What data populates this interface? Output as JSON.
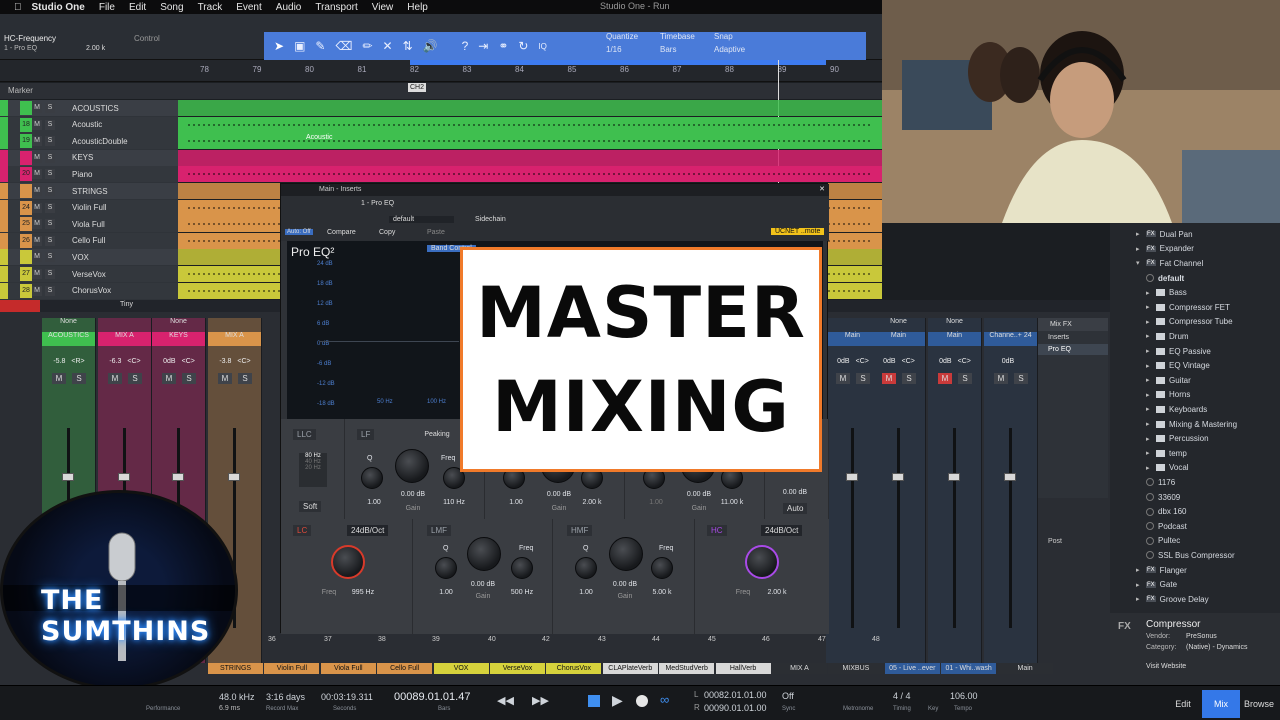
{
  "menubar": {
    "app": "Studio One",
    "items": [
      "File",
      "Edit",
      "Song",
      "Track",
      "Event",
      "Audio",
      "Transport",
      "View",
      "Help"
    ],
    "window_title": "Studio One - Run"
  },
  "toolbar": {
    "param_name": "HC-Frequency",
    "insert_name": "1 - Pro EQ",
    "param_value": "2.00 k",
    "control_label": "Control",
    "quantize_label": "Quantize",
    "quantize_value": "1/16",
    "timebase_label": "Timebase",
    "timebase_value": "Bars",
    "snap_label": "Snap",
    "snap_value": "Adaptive",
    "iq_label": "IQ"
  },
  "ruler": {
    "bars": [
      "78",
      "79",
      "80",
      "81",
      "82",
      "83",
      "84",
      "85",
      "86",
      "87",
      "88",
      "89",
      "90"
    ],
    "marker_label": "Marker",
    "marker_flag": "CH2"
  },
  "tracks": [
    {
      "num": "",
      "name": "ACOUSTICS",
      "color": "#3fbf4f",
      "folder": true
    },
    {
      "num": "18",
      "name": "Acoustic",
      "color": "#3fbf4f",
      "folder": false
    },
    {
      "num": "19",
      "name": "AcousticDouble",
      "color": "#3fbf4f",
      "folder": false
    },
    {
      "num": "",
      "name": "KEYS",
      "color": "#d8226e",
      "folder": true
    },
    {
      "num": "20",
      "name": "Piano",
      "color": "#d8226e",
      "folder": false
    },
    {
      "num": "",
      "name": "STRINGS",
      "color": "#d9944a",
      "folder": true
    },
    {
      "num": "24",
      "name": "Violin Full",
      "color": "#d9944a",
      "folder": false
    },
    {
      "num": "25",
      "name": "Viola Full",
      "color": "#d9944a",
      "folder": false
    },
    {
      "num": "26",
      "name": "Cello Full",
      "color": "#d9944a",
      "folder": false
    },
    {
      "num": "",
      "name": "VOX",
      "color": "#c9c83a",
      "folder": true
    },
    {
      "num": "27",
      "name": "VerseVox",
      "color": "#c9c83a",
      "folder": false
    },
    {
      "num": "28",
      "name": "ChorusVox",
      "color": "#c9c83a",
      "folder": false
    }
  ],
  "acoustic_clip": "Acoustic",
  "mixer_size_label": "Tiny",
  "eq": {
    "window_title": "Main - Inserts",
    "insert_title": "1 - Pro EQ",
    "preset": "default",
    "sidechain": "Sidechain",
    "auto_off": "Auto: Off",
    "compare": "Compare",
    "copy": "Copy",
    "paste": "Paste",
    "brand": "Pro EQ²",
    "band_ctrl": "Band Control",
    "remote": "UCNET ..mote",
    "db_scale": [
      "24 dB",
      "18 dB",
      "12 dB",
      "6 dB",
      "0 dB",
      "-6 dB",
      "-12 dB",
      "-18 dB"
    ],
    "hz_scale": [
      "50 Hz",
      "100 Hz"
    ],
    "llc": {
      "name": "LLC",
      "opts": [
        "80 Hz",
        "40 Hz",
        "20 Hz"
      ],
      "soft": "Soft"
    },
    "lf": {
      "name": "LF",
      "type": "Peaking",
      "q": "Q",
      "freq_l": "Freq",
      "q_val": "1.00",
      "gain_val": "0.00 dB",
      "freq_val": "110 Hz",
      "gain_l": "Gain"
    },
    "lmf_top": {
      "q_val": "1.00",
      "gain_val": "0.00 dB",
      "freq_val": "2.00 k",
      "gain_l": "Gain"
    },
    "hmf_top": {
      "q_val": "1.00",
      "gain_val": "0.00 dB",
      "freq_val": "11.00 k",
      "gain_l": "Gain"
    },
    "hf_top": {
      "gain_val": "0.00 dB",
      "auto": "Auto"
    },
    "lc": {
      "name": "LC",
      "slope": "24dB/Oct",
      "freq_l": "Freq",
      "freq_val": "995 Hz"
    },
    "lmf": {
      "name": "LMF",
      "q": "Q",
      "freq_l": "Freq",
      "q_val": "1.00",
      "gain_val": "0.00 dB",
      "freq_val": "500 Hz",
      "gain_l": "Gain"
    },
    "hmf": {
      "name": "HMF",
      "q": "Q",
      "freq_l": "Freq",
      "q_val": "1.00",
      "gain_val": "0.00 dB",
      "freq_val": "5.00 k",
      "gain_l": "Gain"
    },
    "hc": {
      "name": "HC",
      "slope": "24dB/Oct",
      "freq_l": "Freq",
      "freq_val": "2.00 k"
    }
  },
  "overlay": {
    "line1": "MASTER",
    "line2": "MIXING"
  },
  "logo": {
    "text": "THE SUMTHINS"
  },
  "mixer_channels": [
    {
      "io": "None",
      "name": "ACOUSTICS",
      "vol": "-5.8",
      "pan": "<R>",
      "color": "#3fbf4f"
    },
    {
      "io": "",
      "name": "MIX A",
      "vol": "-6.3",
      "pan": "<C>",
      "color": "#d8226e"
    },
    {
      "io": "None",
      "name": "KEYS",
      "vol": "0dB",
      "pan": "<C>",
      "color": "#d8226e"
    },
    {
      "io": "",
      "name": "MIX A",
      "vol": "-3.8",
      "pan": "<C>",
      "color": "#d9944a"
    },
    {
      "io": "",
      "name": "Main",
      "vol": "0dB",
      "pan": "<C>",
      "color": "#2f5b9a"
    },
    {
      "io": "None",
      "name": "Main",
      "vol": "0dB",
      "pan": "<C>",
      "color": "#2f5b9a"
    },
    {
      "io": "None",
      "name": "Main",
      "vol": "0dB",
      "pan": "<C>",
      "color": "#2f5b9a"
    },
    {
      "io": "",
      "name": "Channe..+ 24",
      "vol": "0dB",
      "pan": "",
      "color": "#2f5b9a"
    }
  ],
  "mixfx": {
    "title": "Mix FX",
    "inserts": "Inserts",
    "insert1": "Pro EQ",
    "post": "Post"
  },
  "channel_numbers": [
    "36",
    "37",
    "38",
    "39",
    "40",
    "42",
    "43",
    "44",
    "45",
    "46",
    "47",
    "48"
  ],
  "channel_labels": [
    {
      "text": "STRINGS",
      "color": "#d9944a"
    },
    {
      "text": "Violin Full",
      "color": "#d9944a"
    },
    {
      "text": "Viola Full",
      "color": "#d9944a"
    },
    {
      "text": "Cello Full",
      "color": "#d9944a"
    },
    {
      "text": "VOX",
      "color": "#d6d23c"
    },
    {
      "text": "VerseVox",
      "color": "#d6d23c"
    },
    {
      "text": "ChorusVox",
      "color": "#d6d23c"
    },
    {
      "text": "CLAPlateVerb",
      "color": "#d8d8d8"
    },
    {
      "text": "MedStudVerb",
      "color": "#d8d8d8"
    },
    {
      "text": "HallVerb",
      "color": "#d8d8d8"
    },
    {
      "text": "MIX A",
      "color": "#2b2e33"
    },
    {
      "text": "MIXBUS",
      "color": "#2b2e33"
    },
    {
      "text": "05 - Live ..ever",
      "color": "#2f5b9a"
    },
    {
      "text": "01 - Whi..wash",
      "color": "#2f5b9a"
    },
    {
      "text": "Main",
      "color": "#2b2e33"
    }
  ],
  "browser": {
    "items": [
      {
        "t": "Dual Pan",
        "k": "fx",
        "ind": 0
      },
      {
        "t": "Expander",
        "k": "fx",
        "ind": 0
      },
      {
        "t": "Fat Channel",
        "k": "fx-open",
        "ind": 0
      },
      {
        "t": "default",
        "k": "preset",
        "ind": 1
      },
      {
        "t": "Bass",
        "k": "folder",
        "ind": 1
      },
      {
        "t": "Compressor FET",
        "k": "folder",
        "ind": 1
      },
      {
        "t": "Compressor Tube",
        "k": "folder",
        "ind": 1
      },
      {
        "t": "Drum",
        "k": "folder",
        "ind": 1
      },
      {
        "t": "EQ Passive",
        "k": "folder",
        "ind": 1
      },
      {
        "t": "EQ Vintage",
        "k": "folder",
        "ind": 1
      },
      {
        "t": "Guitar",
        "k": "folder",
        "ind": 1
      },
      {
        "t": "Horns",
        "k": "folder",
        "ind": 1
      },
      {
        "t": "Keyboards",
        "k": "folder",
        "ind": 1
      },
      {
        "t": "Mixing & Mastering",
        "k": "folder",
        "ind": 1
      },
      {
        "t": "Percussion",
        "k": "folder",
        "ind": 1
      },
      {
        "t": "temp",
        "k": "folder",
        "ind": 1
      },
      {
        "t": "Vocal",
        "k": "folder",
        "ind": 1
      },
      {
        "t": "1176",
        "k": "preset",
        "ind": 1
      },
      {
        "t": "33609",
        "k": "preset",
        "ind": 1
      },
      {
        "t": "dbx 160",
        "k": "preset",
        "ind": 1
      },
      {
        "t": "Podcast",
        "k": "preset",
        "ind": 1
      },
      {
        "t": "Pultec",
        "k": "preset",
        "ind": 1
      },
      {
        "t": "SSL Bus Compressor",
        "k": "preset",
        "ind": 1
      },
      {
        "t": "Flanger",
        "k": "fx",
        "ind": 0
      },
      {
        "t": "Gate",
        "k": "fx",
        "ind": 0
      },
      {
        "t": "Groove Delay",
        "k": "fx",
        "ind": 0
      }
    ],
    "info_name": "Compressor",
    "info_vendor_l": "Vendor:",
    "info_vendor": "PreSonus",
    "info_cat_l": "Category:",
    "info_cat": "(Native) - Dynamics",
    "visit": "Visit Website",
    "fx_badge": "FX"
  },
  "transport": {
    "sample_rate": "48.0 kHz",
    "latency": "6.9 ms",
    "record_days": "3:16 days",
    "record_max": "Record Max",
    "seconds_val": "00:03:19.311",
    "seconds_l": "Seconds",
    "bars_val": "00089.01.01.47",
    "bars_l": "Bars",
    "loop_l": "00082.01.01.00",
    "loop_r": "00090.01.01.00",
    "l_mark": "L",
    "r_mark": "R",
    "off": "Off",
    "sync": "Sync",
    "metronome": "Metronome",
    "timing": "Timing",
    "sig": "4 / 4",
    "key_l": "Key",
    "tempo_val": "106.00",
    "tempo_l": "Tempo",
    "perf": "Performance"
  },
  "view_tabs": {
    "edit": "Edit",
    "mix": "Mix",
    "browse": "Browse"
  }
}
